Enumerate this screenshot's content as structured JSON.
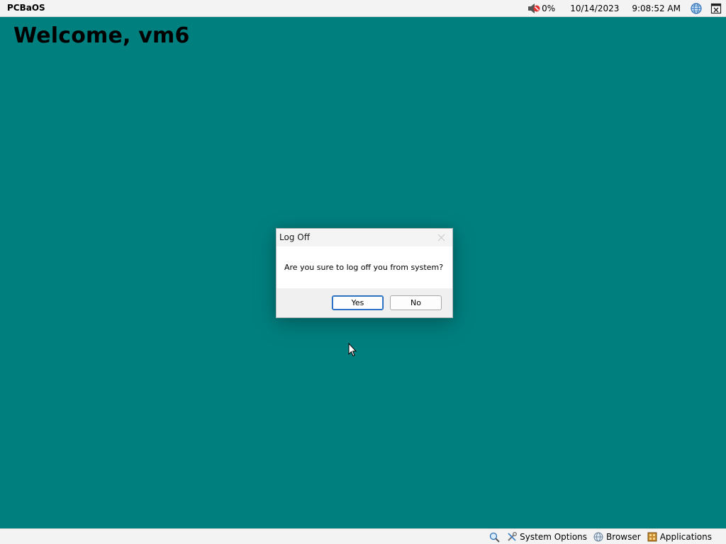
{
  "topbar": {
    "brand": "PCBaOS",
    "volume_icon": "volume-muted-icon",
    "volume": "0%",
    "date": "10/14/2023",
    "time": "9:08:52 AM",
    "network_icon": "globe-icon",
    "window_icon": "window-close-icon"
  },
  "desktop": {
    "welcome": "Welcome, vm6",
    "background_color": "#007f7f"
  },
  "dialog": {
    "title": "Log Off",
    "close_icon": "close-icon",
    "message": "Are you sure to log off you from system?",
    "yes_label": "Yes",
    "no_label": "No",
    "accent": "#1a5fb4"
  },
  "bottombar": {
    "search_icon": "search-icon",
    "items": [
      {
        "icon": "tools-icon",
        "label": "System Options"
      },
      {
        "icon": "browser-globe-icon",
        "label": "Browser"
      },
      {
        "icon": "applications-folder-icon",
        "label": "Applications"
      }
    ]
  }
}
